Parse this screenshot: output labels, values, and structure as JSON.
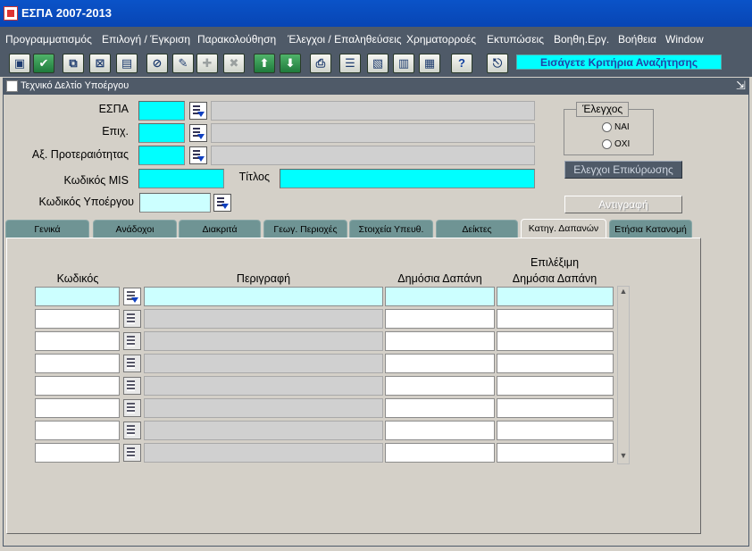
{
  "window": {
    "title": "ΕΣΠΑ 2007-2013"
  },
  "menu": [
    "Προγραμματισμός",
    "Επιλογή / Έγκριση",
    "Παρακολούθηση",
    "Έλεγχοι / Επαληθεύσεις",
    "Χρηματορροές",
    "Εκτυπώσεις",
    "Βοηθη.Εργ.",
    "Βοήθεια",
    "Window"
  ],
  "toolbar": {
    "hint": "Εισάγετε Κριτήρια Αναζήτησης",
    "help_glyph": "?"
  },
  "form": {
    "title": "Τεχνικό Δελτίο Υποέργου",
    "labels": {
      "espa": "ΕΣΠΑ",
      "epix": "Επιχ.",
      "axis": "Αξ. Προτεραιότητας",
      "mis": "Κωδικός MIS",
      "title": "Τίτλος",
      "subproject": "Κωδικός Υποέργου"
    },
    "controls": {
      "legend": "Έλεγχος",
      "yes": "ΝΑΙ",
      "no": "ΟΧΙ"
    },
    "buttons": {
      "validate": "Ελεγχοι Επικύρωσης",
      "copy": "Αντιγραφή"
    }
  },
  "tabs": [
    "Γενικά",
    "Ανάδοχοι",
    "Διακριτά",
    "Γεωγ. Περιοχές",
    "Στοιχεία Υπευθ.",
    "Δείκτες",
    "Κατηγ. Δαπανών",
    "Ετήσια Κατανομή"
  ],
  "active_tab": "Κατηγ. Δαπανών",
  "grid": {
    "headers": {
      "code": "Κωδικός",
      "description": "Περιγραφή",
      "public_expense": "Δημόσια Δαπάνη",
      "eligible_line1": "Επιλέξιμη",
      "eligible_line2": "Δημόσια Δαπάνη"
    }
  },
  "colors": {
    "required_field": "#00ffff",
    "query_field": "#ccffff",
    "bar": "#4f5a68",
    "tab": "#6f9494"
  }
}
